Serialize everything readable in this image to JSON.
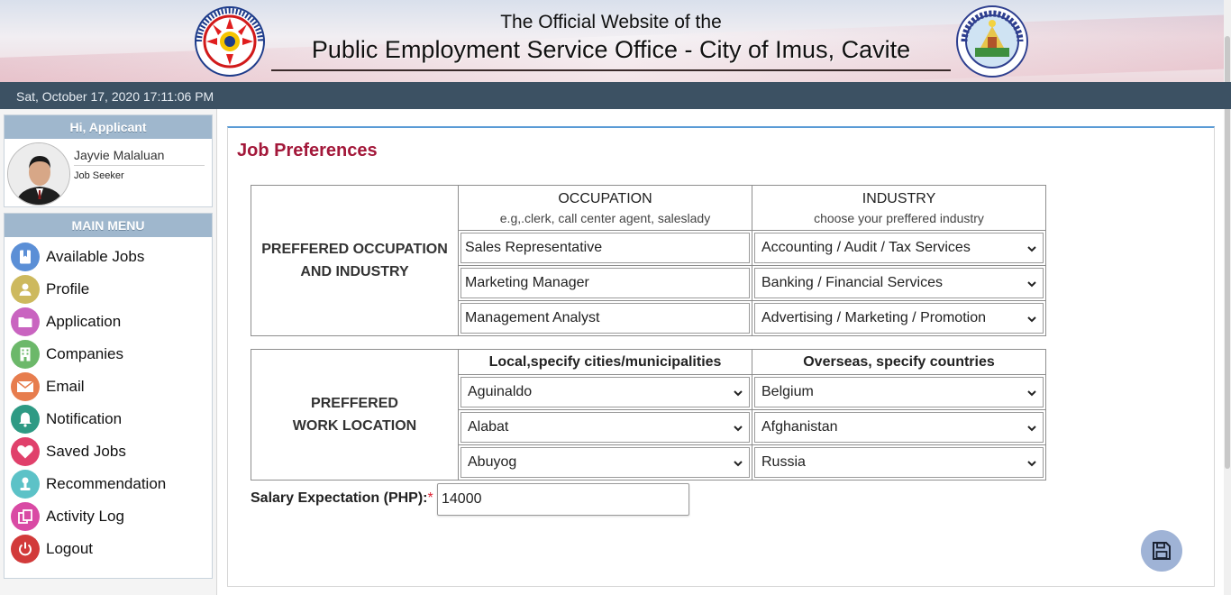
{
  "header": {
    "line1": "The Official Website of the",
    "line2": "Public Employment Service Office - City of Imus, Cavite"
  },
  "datebar": {
    "text": "Sat, October 17, 2020 17:11:06 PM"
  },
  "user_panel": {
    "greeting": "Hi, Applicant",
    "name": "Jayvie Malaluan",
    "role": "Job Seeker"
  },
  "menu": {
    "title": "MAIN MENU",
    "items": [
      {
        "label": "Available Jobs",
        "icon": "bookmark-icon",
        "color": "#5b8fd6"
      },
      {
        "label": "Profile",
        "icon": "user-icon",
        "color": "#cdb95e"
      },
      {
        "label": "Application",
        "icon": "folder-icon",
        "color": "#c964c0"
      },
      {
        "label": "Companies",
        "icon": "building-icon",
        "color": "#6cb86a"
      },
      {
        "label": "Email",
        "icon": "envelope-icon",
        "color": "#e77d4e"
      },
      {
        "label": "Notification",
        "icon": "bell-icon",
        "color": "#2e9a84"
      },
      {
        "label": "Saved Jobs",
        "icon": "heart-icon",
        "color": "#e0406b"
      },
      {
        "label": "Recommendation",
        "icon": "award-icon",
        "color": "#5cc2c7"
      },
      {
        "label": "Activity Log",
        "icon": "copy-icon",
        "color": "#d94aa4"
      },
      {
        "label": "Logout",
        "icon": "power-icon",
        "color": "#d23a3a"
      }
    ]
  },
  "main": {
    "title": "Job Preferences",
    "occupation_section": {
      "label": "PREFFERED OCCUPATION AND INDUSTRY",
      "occupation_head": "OCCUPATION",
      "occupation_sub": "e.g,.clerk, call center agent, saleslady",
      "industry_head": "INDUSTRY",
      "industry_sub": "choose your preffered industry",
      "occupations": [
        "Sales Representative",
        "Marketing Manager",
        "Management Analyst"
      ],
      "industries": [
        "Accounting / Audit / Tax Services",
        "Banking / Financial Services",
        "Advertising / Marketing / Promotion"
      ]
    },
    "location_section": {
      "label": "PREFFERED WORK LOCATION",
      "local_head": "Local,specify cities/municipalities",
      "overseas_head": "Overseas, specify countries",
      "local": [
        "Aguinaldo",
        "Alabat",
        "Abuyog"
      ],
      "overseas": [
        "Belgium",
        "Afghanistan",
        "Russia"
      ]
    },
    "salary": {
      "label": "Salary Expectation (PHP):",
      "required_mark": "*",
      "value": "14000"
    }
  },
  "colors": {
    "accent_title": "#a3183a",
    "datebar_bg": "#3c5163",
    "panel_head_bg": "#9fb7cd",
    "save_button_bg": "#9fb3d6"
  }
}
